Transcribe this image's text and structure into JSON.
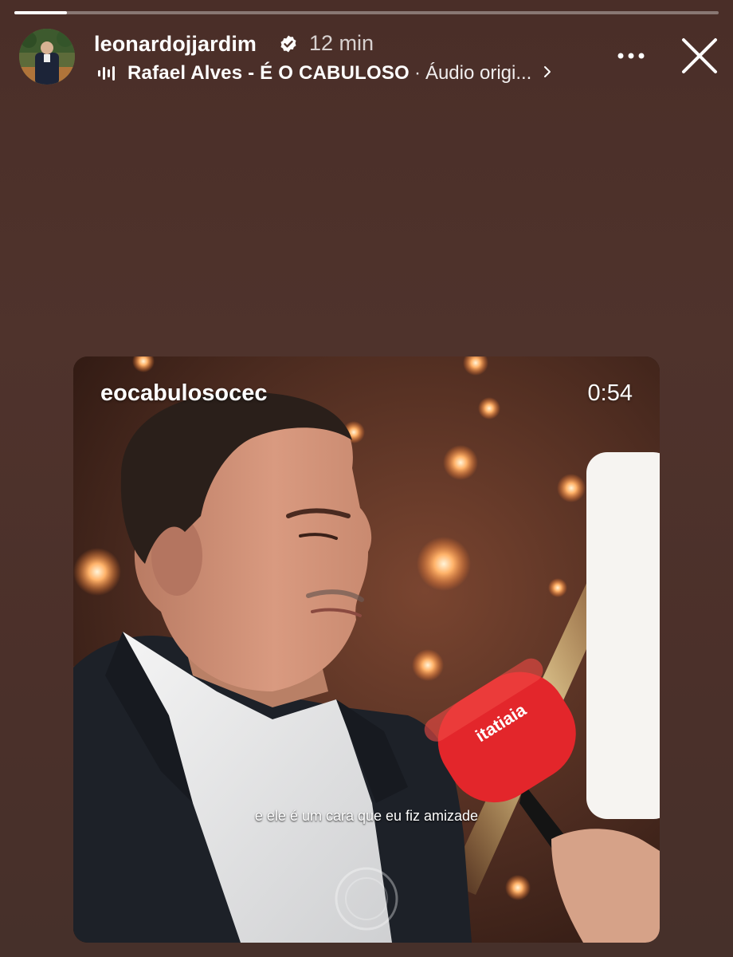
{
  "story": {
    "progress_fraction": 0.075,
    "username": "leonardojjardim",
    "verified": true,
    "time_ago": "12 min",
    "audio": {
      "artist": "Rafael Alves - É O CABULOSO",
      "separator": "·",
      "title": "Áudio origi..."
    }
  },
  "video": {
    "owner": "eocabulosocec",
    "duration": "0:54",
    "caption": "e ele é um cara que eu fiz amizade",
    "mic_brand": "itatiaia"
  },
  "colors": {
    "background": "#4b302a",
    "mic_red": "#e3262b",
    "white": "#ffffff"
  },
  "icons": [
    "verified-badge-icon",
    "audio-wave-icon",
    "chevron-right-icon",
    "more-options-icon",
    "close-icon"
  ]
}
